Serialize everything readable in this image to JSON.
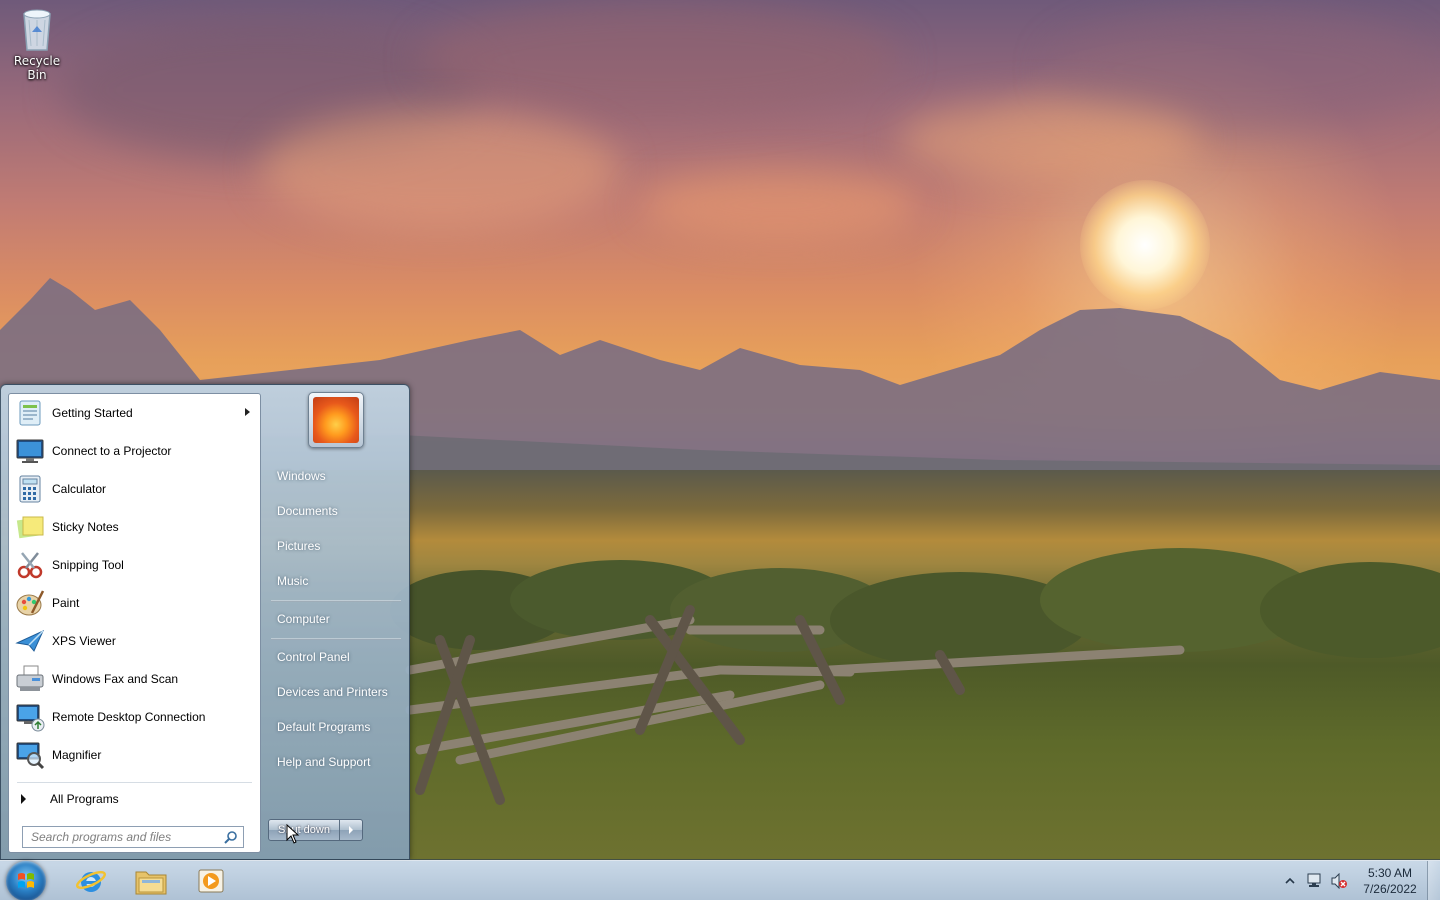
{
  "desktop": {
    "icons": [
      {
        "label": "Recycle Bin",
        "icon": "recycle-bin-icon"
      }
    ]
  },
  "start_menu": {
    "programs": [
      {
        "label": "Getting Started",
        "icon": "getting-started-icon",
        "has_submenu": true
      },
      {
        "label": "Connect to a Projector",
        "icon": "projector-icon"
      },
      {
        "label": "Calculator",
        "icon": "calculator-icon"
      },
      {
        "label": "Sticky Notes",
        "icon": "sticky-notes-icon"
      },
      {
        "label": "Snipping Tool",
        "icon": "snipping-tool-icon"
      },
      {
        "label": "Paint",
        "icon": "paint-icon"
      },
      {
        "label": "XPS Viewer",
        "icon": "xps-viewer-icon"
      },
      {
        "label": "Windows Fax and Scan",
        "icon": "fax-scan-icon"
      },
      {
        "label": "Remote Desktop Connection",
        "icon": "remote-desktop-icon"
      },
      {
        "label": "Magnifier",
        "icon": "magnifier-icon"
      }
    ],
    "all_programs": "All Programs",
    "search": {
      "placeholder": "Search programs and files",
      "value": ""
    },
    "right_links": [
      {
        "label": "Windows"
      },
      {
        "label": "Documents"
      },
      {
        "label": "Pictures"
      },
      {
        "label": "Music"
      },
      {
        "label": "Computer"
      },
      {
        "label": "Control Panel"
      },
      {
        "label": "Devices and Printers"
      },
      {
        "label": "Default Programs"
      },
      {
        "label": "Help and Support"
      }
    ],
    "shutdown_label": "Shut down"
  },
  "taskbar": {
    "pinned": [
      {
        "name": "Internet Explorer",
        "icon": "internet-explorer-icon"
      },
      {
        "name": "Windows Explorer",
        "icon": "file-explorer-icon"
      },
      {
        "name": "Windows Media Player",
        "icon": "media-player-icon"
      }
    ],
    "clock": {
      "time": "5:30 AM",
      "date": "7/26/2022"
    },
    "tray_icons": [
      "show-hidden-icons-icon",
      "network-icon",
      "volume-muted-icon"
    ]
  },
  "colors": {
    "taskbar": "#b9cadb",
    "start_menu_frame": "#a7bccd",
    "start_menu_left": "#ffffff"
  }
}
